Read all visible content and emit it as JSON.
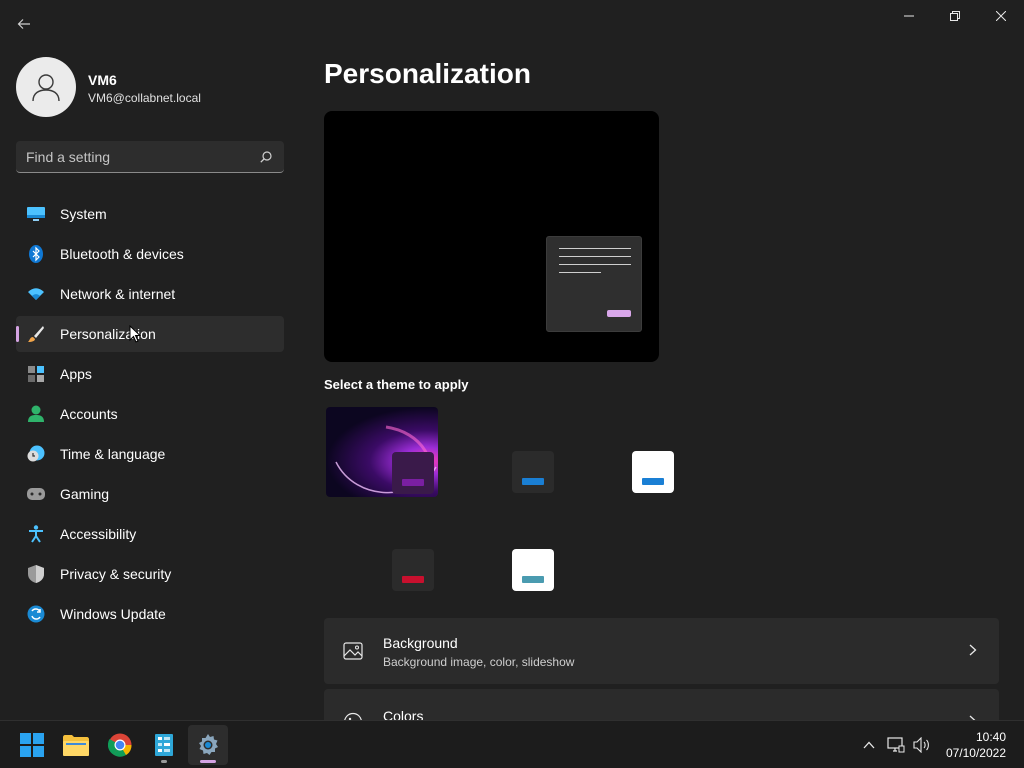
{
  "window": {
    "controls": {
      "minimize": "—",
      "restore": "❐",
      "close": "✕"
    }
  },
  "profile": {
    "name": "VM6",
    "email": "VM6@collabnet.local"
  },
  "search": {
    "placeholder": "Find a setting"
  },
  "nav": {
    "items": [
      {
        "label": "System",
        "icon": "system-icon"
      },
      {
        "label": "Bluetooth & devices",
        "icon": "bluetooth-icon"
      },
      {
        "label": "Network & internet",
        "icon": "wifi-icon"
      },
      {
        "label": "Personalization",
        "icon": "brush-icon",
        "selected": true
      },
      {
        "label": "Apps",
        "icon": "apps-icon"
      },
      {
        "label": "Accounts",
        "icon": "accounts-icon"
      },
      {
        "label": "Time & language",
        "icon": "clock-icon"
      },
      {
        "label": "Gaming",
        "icon": "controller-icon"
      },
      {
        "label": "Accessibility",
        "icon": "accessibility-icon"
      },
      {
        "label": "Privacy & security",
        "icon": "shield-icon"
      },
      {
        "label": "Windows Update",
        "icon": "update-icon"
      }
    ]
  },
  "main": {
    "title": "Personalization",
    "themes_label": "Select a theme to apply",
    "themes": [
      {
        "name": "glow-theme",
        "accent": "#7a1fa2"
      },
      {
        "name": "dark-blue-theme",
        "accent": "#1a7fd4"
      },
      {
        "name": "light-blue-theme",
        "accent": "#1a7fd4"
      },
      {
        "name": "dark-red-theme",
        "accent": "#c8102e"
      },
      {
        "name": "light-teal-theme",
        "accent": "#4a9bb0"
      }
    ],
    "cards": [
      {
        "title": "Background",
        "subtitle": "Background image, color, slideshow",
        "icon": "image-icon"
      },
      {
        "title": "Colors",
        "subtitle": "",
        "icon": "palette-icon"
      }
    ]
  },
  "taskbar": {
    "apps": [
      "start-button",
      "file-explorer",
      "chrome",
      "azure-data-studio",
      "settings"
    ],
    "time": "10:40",
    "date": "07/10/2022"
  },
  "colors": {
    "accent": "#d4a3e3",
    "background": "#202020",
    "card": "#2b2b2b"
  }
}
